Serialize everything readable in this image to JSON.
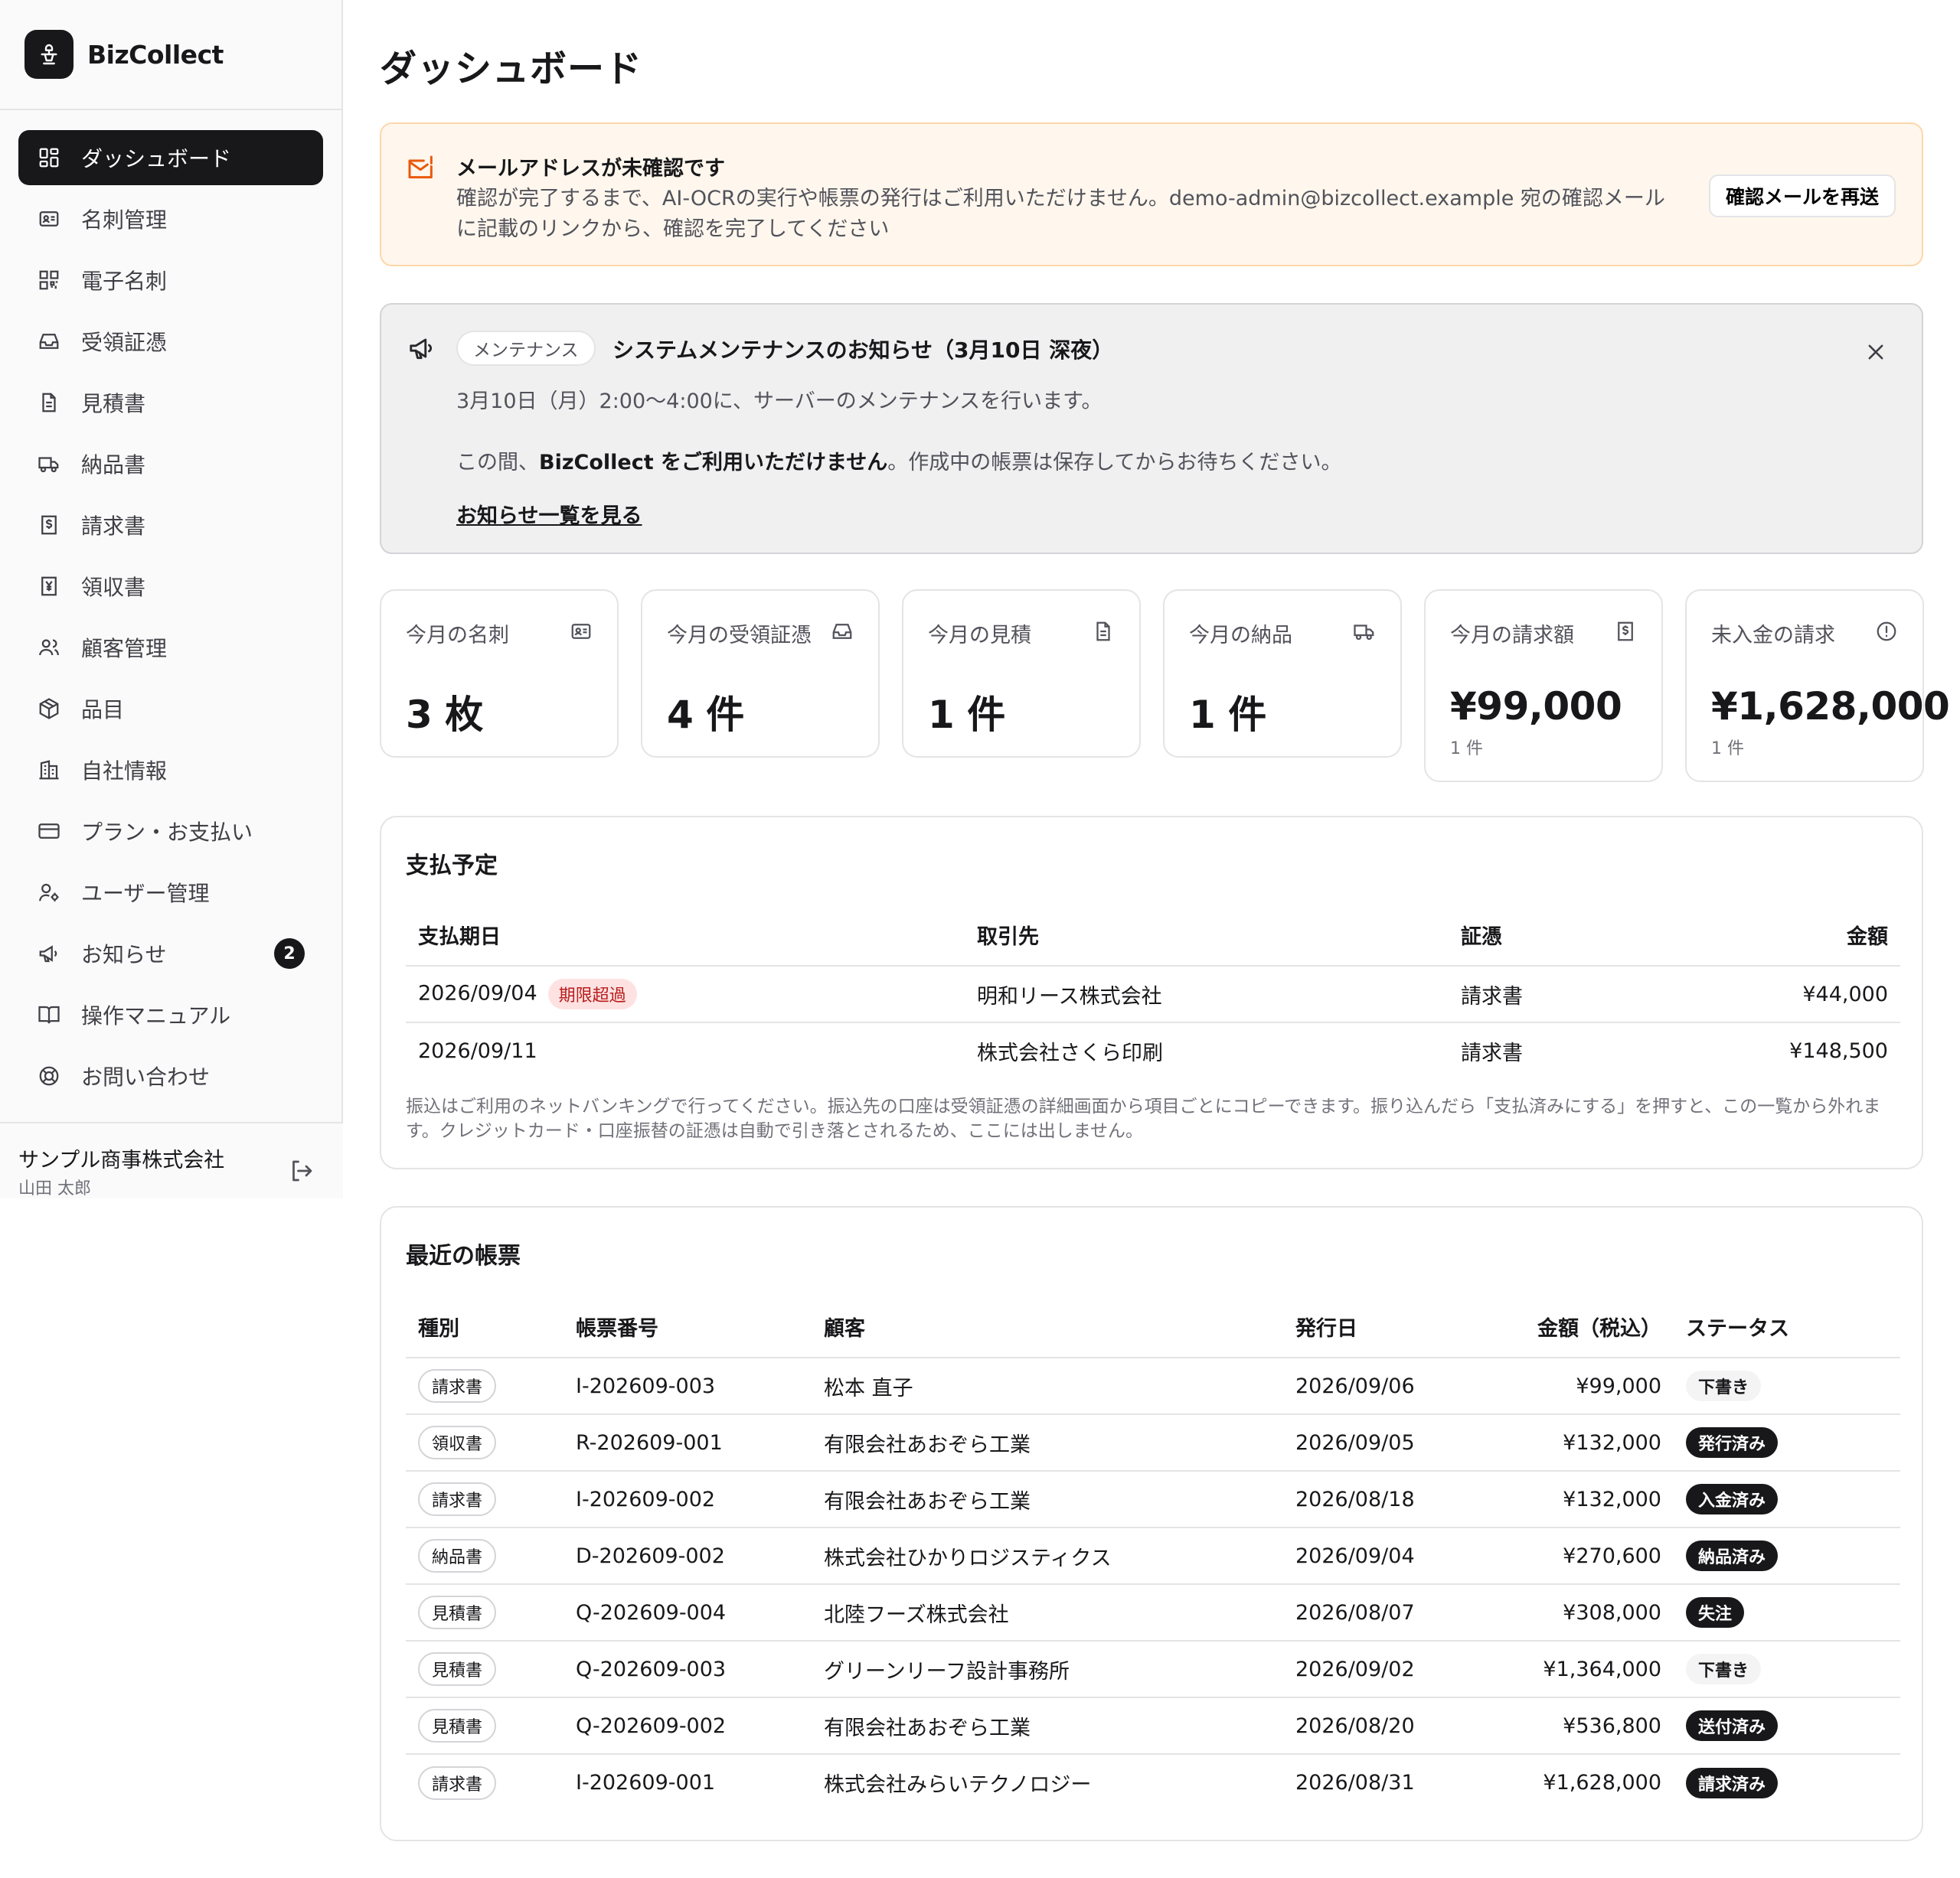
{
  "brand": {
    "name": "BizCollect"
  },
  "sidebar": {
    "items": [
      {
        "label": "ダッシュボード",
        "icon": "dashboard-icon"
      },
      {
        "label": "名刺管理",
        "icon": "id-card-icon"
      },
      {
        "label": "電子名刺",
        "icon": "qr-code-icon"
      },
      {
        "label": "受領証憑",
        "icon": "inbox-icon"
      },
      {
        "label": "見積書",
        "icon": "document-icon"
      },
      {
        "label": "納品書",
        "icon": "truck-icon"
      },
      {
        "label": "請求書",
        "icon": "receipt-dollar-icon"
      },
      {
        "label": "領収書",
        "icon": "receipt-yen-icon"
      },
      {
        "label": "顧客管理",
        "icon": "users-icon"
      },
      {
        "label": "品目",
        "icon": "package-icon"
      },
      {
        "label": "自社情報",
        "icon": "building-icon"
      },
      {
        "label": "プラン・お支払い",
        "icon": "credit-card-icon"
      },
      {
        "label": "ユーザー管理",
        "icon": "user-cog-icon"
      },
      {
        "label": "お知らせ",
        "icon": "megaphone-icon",
        "badge": "2"
      },
      {
        "label": "操作マニュアル",
        "icon": "book-icon"
      },
      {
        "label": "お問い合わせ",
        "icon": "lifebuoy-icon"
      }
    ],
    "company": "サンプル商事株式会社",
    "user": "山田 太郎"
  },
  "page": {
    "title": "ダッシュボード"
  },
  "email_alert": {
    "title": "メールアドレスが未確認です",
    "text": "確認が完了するまで、AI-OCRの実行や帳票の発行はご利用いただけません。demo-admin@bizcollect.example 宛の確認メールに記載のリンクから、確認を完了してください",
    "button": "確認メールを再送"
  },
  "notice": {
    "tag": "メンテナンス",
    "title": "システムメンテナンスのお知らせ（3月10日 深夜）",
    "line1": "3月10日（月）2:00〜4:00に、サーバーのメンテナンスを行います。",
    "line2_prefix": "この間、",
    "line2_bold": "BizCollect をご利用いただけません",
    "line2_suffix": "。作成中の帳票は保存してからお待ちください。",
    "link": "お知らせ一覧を見る"
  },
  "stats": [
    {
      "label": "今月の名刺",
      "value": "3 枚",
      "sub": "",
      "icon": "id-card-icon"
    },
    {
      "label": "今月の受領証憑",
      "value": "4 件",
      "sub": "",
      "icon": "inbox-icon"
    },
    {
      "label": "今月の見積",
      "value": "1 件",
      "sub": "",
      "icon": "document-icon"
    },
    {
      "label": "今月の納品",
      "value": "1 件",
      "sub": "",
      "icon": "truck-icon"
    },
    {
      "label": "今月の請求額",
      "value": "¥99,000",
      "sub": "1 件",
      "icon": "receipt-dollar-icon"
    },
    {
      "label": "未入金の請求",
      "value": "¥1,628,000",
      "sub": "1 件",
      "icon": "alert-circle-icon"
    }
  ],
  "payments": {
    "title": "支払予定",
    "headers": [
      "支払期日",
      "取引先",
      "証憑",
      "金額"
    ],
    "rows": [
      {
        "date": "2026/09/04",
        "badge": "期限超過",
        "partner": "明和リース株式会社",
        "doc": "請求書",
        "amount": "¥44,000"
      },
      {
        "date": "2026/09/11",
        "badge": "",
        "partner": "株式会社さくら印刷",
        "doc": "請求書",
        "amount": "¥148,500"
      }
    ],
    "note": "振込はご利用のネットバンキングで行ってください。振込先の口座は受領証憑の詳細画面から項目ごとにコピーできます。振り込んだら「支払済みにする」を押すと、この一覧から外れます。クレジットカード・口座振替の証憑は自動で引き落とされるため、ここには出しません。"
  },
  "recent": {
    "title": "最近の帳票",
    "headers": [
      "種別",
      "帳票番号",
      "顧客",
      "発行日",
      "金額（税込）",
      "ステータス"
    ],
    "rows": [
      {
        "type": "請求書",
        "number": "I-202609-003",
        "customer": "松本 直子",
        "date": "2026/09/06",
        "amount": "¥99,000",
        "status": "下書き",
        "style": "light"
      },
      {
        "type": "領収書",
        "number": "R-202609-001",
        "customer": "有限会社あおぞら工業",
        "date": "2026/09/05",
        "amount": "¥132,000",
        "status": "発行済み",
        "style": "dark"
      },
      {
        "type": "請求書",
        "number": "I-202609-002",
        "customer": "有限会社あおぞら工業",
        "date": "2026/08/18",
        "amount": "¥132,000",
        "status": "入金済み",
        "style": "dark"
      },
      {
        "type": "納品書",
        "number": "D-202609-002",
        "customer": "株式会社ひかりロジスティクス",
        "date": "2026/09/04",
        "amount": "¥270,600",
        "status": "納品済み",
        "style": "dark"
      },
      {
        "type": "見積書",
        "number": "Q-202609-004",
        "customer": "北陸フーズ株式会社",
        "date": "2026/08/07",
        "amount": "¥308,000",
        "status": "失注",
        "style": "dark"
      },
      {
        "type": "見積書",
        "number": "Q-202609-003",
        "customer": "グリーンリーフ設計事務所",
        "date": "2026/09/02",
        "amount": "¥1,364,000",
        "status": "下書き",
        "style": "light"
      },
      {
        "type": "見積書",
        "number": "Q-202609-002",
        "customer": "有限会社あおぞら工業",
        "date": "2026/08/20",
        "amount": "¥536,800",
        "status": "送付済み",
        "style": "dark"
      },
      {
        "type": "請求書",
        "number": "I-202609-001",
        "customer": "株式会社みらいテクノロジー",
        "date": "2026/08/31",
        "amount": "¥1,628,000",
        "status": "請求済み",
        "style": "dark"
      }
    ]
  },
  "colors": {
    "accent": "#18181b",
    "alert_bg": "#fff7ed",
    "alert_icon": "#ea580c",
    "overdue": "#b91c1c",
    "notice_bg": "#f0f0f1"
  }
}
